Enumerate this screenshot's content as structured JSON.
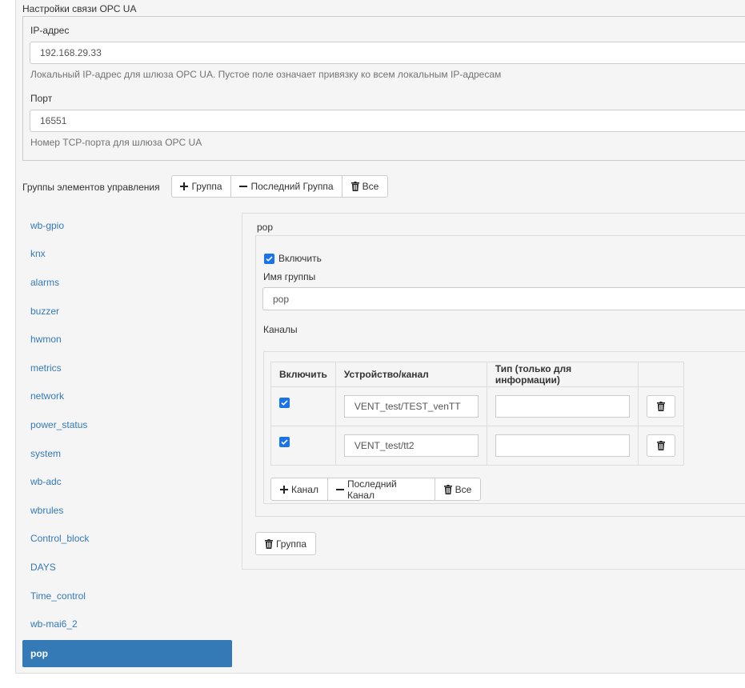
{
  "opc": {
    "section_title": "Настройки связи OPC UA",
    "ip_label": "IP-адрес",
    "ip_value": "192.168.29.33",
    "ip_help": "Локальный IP-адрес для шлюза OPC UA. Пустое поле означает привязку ко всем локальным IP-адресам",
    "port_label": "Порт",
    "port_value": "16551",
    "port_help": "Номер TCP-порта для шлюза OPC UA"
  },
  "groups": {
    "label": "Группы элементов управления",
    "add_label": "Группа",
    "remove_last_label": "Последний Группа",
    "remove_all_label": "Все",
    "nav": [
      "wb-gpio",
      "knx",
      "alarms",
      "buzzer",
      "hwmon",
      "metrics",
      "network",
      "power_status",
      "system",
      "wb-adc",
      "wbrules",
      "Control_block",
      "DAYS",
      "Time_control",
      "wb-mai6_2",
      "pop"
    ],
    "active": "pop"
  },
  "group": {
    "title": "pop",
    "enable_label": "Включить",
    "name_label": "Имя группы",
    "name_value": "pop",
    "channels_label": "Каналы",
    "delete_group_label": "Группа"
  },
  "channels": {
    "headers": [
      "Включить",
      "Устройство/канал",
      "Тип (только для информации)"
    ],
    "rows": [
      {
        "enabled": true,
        "device": "VENT_test/TEST_venTT",
        "type": ""
      },
      {
        "enabled": true,
        "device": "VENT_test/tt2",
        "type": ""
      }
    ],
    "add_label": "Канал",
    "remove_last_label": "Последний Канал",
    "remove_all_label": "Все"
  },
  "icons": {
    "plus": "plus-icon",
    "minus": "minus-icon",
    "trash": "trash-icon",
    "check": "check-icon"
  },
  "colors": {
    "accent": "#337ab7",
    "checkbox": "#1a73e8"
  }
}
